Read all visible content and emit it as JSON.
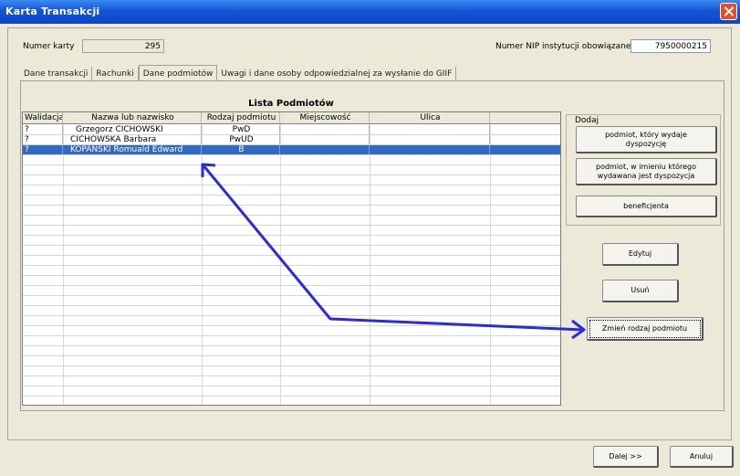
{
  "window": {
    "title": "Karta Transakcji"
  },
  "header": {
    "card_number_label": "Numer karty",
    "card_number_value": "295",
    "nip_label": "Numer NIP instytucji obowiązanej",
    "nip_value": "7950000215"
  },
  "tabs": [
    {
      "label": "Dane transakcji"
    },
    {
      "label": "Rachunki"
    },
    {
      "label": "Dane podmiotów"
    },
    {
      "label": "Uwagi i dane osoby odpowiedzialnej za wysłanie do GIIF"
    }
  ],
  "list": {
    "title": "Lista Podmiotów",
    "columns": [
      "Walidacja",
      "Nazwa lub nazwisko",
      "Rodzaj podmiotu",
      "Miejscowość",
      "Ulica",
      ""
    ],
    "rows": [
      {
        "walidacja": "?",
        "nazwa": "Grzegorz CICHOWSKI",
        "rodzaj": "PwD",
        "miejscowosc": "",
        "ulica": ""
      },
      {
        "walidacja": "?",
        "nazwa": "CICHOWSKA Barbara",
        "rodzaj": "PwUD",
        "miejscowosc": "",
        "ulica": ""
      },
      {
        "walidacja": "?",
        "nazwa": "KOPANSKI Romuald Edward",
        "rodzaj": "B",
        "miejscowosc": "",
        "ulica": ""
      }
    ]
  },
  "add_group": {
    "label": "Dodaj",
    "btn1_line1": "podmiot, który wydaje",
    "btn1_line2": "dyspozycję",
    "btn2_line1": "podmiot, w imieniu którego",
    "btn2_line2": "wydawana jest dyspozycja",
    "btn3": "beneficjenta"
  },
  "actions": {
    "edit": "Edytuj",
    "delete": "Usuń",
    "change_type": "Zmień rodzaj podmiotu"
  },
  "footer": {
    "next": "Dalej >>",
    "cancel": "Anuluj"
  },
  "colors": {
    "title_bar": "#0a46c8",
    "selection": "#316ac5",
    "annotation_arrow": "#2a2adf"
  },
  "icons": [
    "close-icon",
    "annotation-arrow"
  ]
}
